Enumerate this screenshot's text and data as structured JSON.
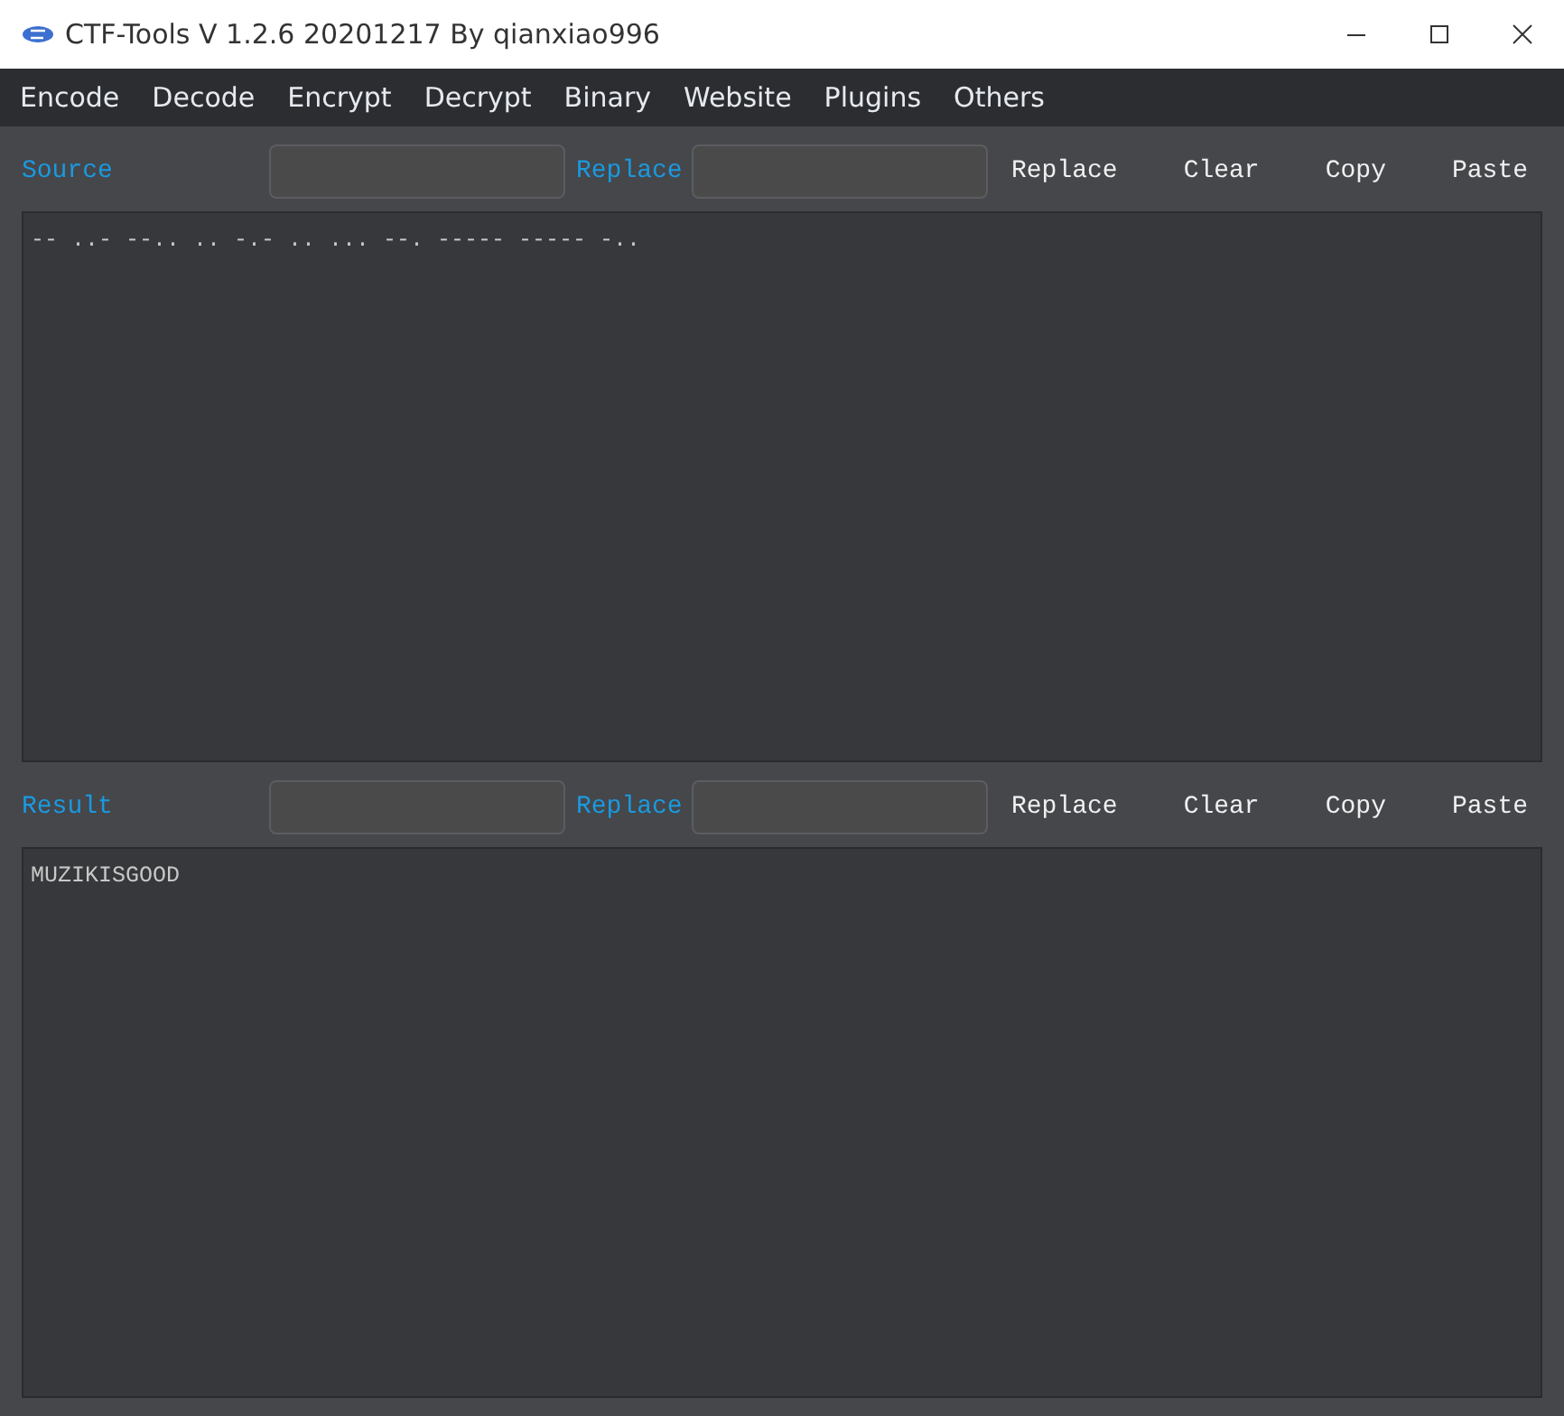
{
  "window": {
    "title": "CTF-Tools V 1.2.6 20201217 By qianxiao996"
  },
  "menu": [
    "Encode",
    "Decode",
    "Encrypt",
    "Decrypt",
    "Binary",
    "Website",
    "Plugins",
    "Others"
  ],
  "sections": [
    {
      "label": "Source",
      "replace_label": "Replace",
      "buttons": [
        "Replace",
        "Clear",
        "Copy",
        "Paste"
      ],
      "text": "-- ..- --.. .. -.- .. ... --. ----- ----- -.."
    },
    {
      "label": "Result",
      "replace_label": "Replace",
      "buttons": [
        "Replace",
        "Clear",
        "Copy",
        "Paste"
      ],
      "text": "MUZIKISGOOD"
    }
  ]
}
